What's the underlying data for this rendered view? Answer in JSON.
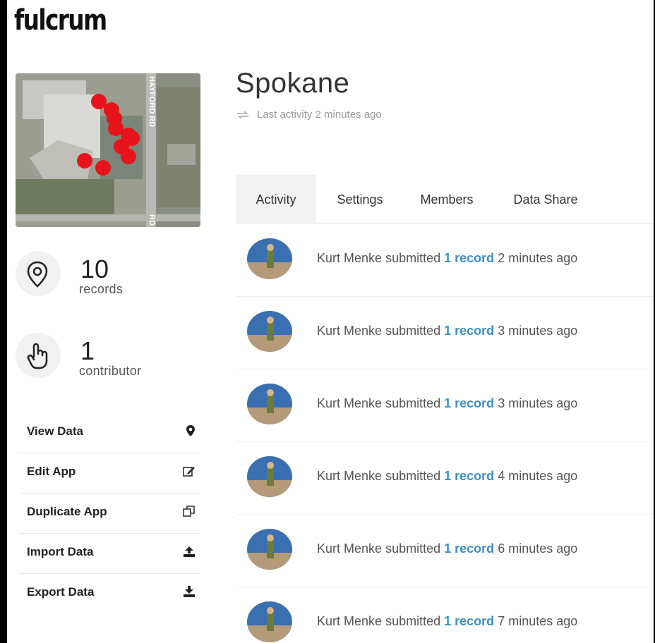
{
  "brand": {
    "logo_text": "fulcrum"
  },
  "app": {
    "title": "Spokane",
    "last_activity": "Last activity 2 minutes ago",
    "map_street_label": "HAYFORD RD",
    "map_street_label_2": "RD"
  },
  "stats": {
    "records": {
      "value": "10",
      "label": "records",
      "icon": "map-pin-icon"
    },
    "contributors": {
      "value": "1",
      "label": "contributor",
      "icon": "hand-pointer-icon"
    }
  },
  "actions": [
    {
      "label": "View Data",
      "icon": "map-marker-icon"
    },
    {
      "label": "Edit App",
      "icon": "edit-icon"
    },
    {
      "label": "Duplicate App",
      "icon": "duplicate-icon"
    },
    {
      "label": "Import Data",
      "icon": "upload-icon"
    },
    {
      "label": "Export Data",
      "icon": "download-icon"
    }
  ],
  "tabs": [
    {
      "label": "Activity",
      "active": true
    },
    {
      "label": "Settings",
      "active": false
    },
    {
      "label": "Members",
      "active": false
    },
    {
      "label": "Data Share",
      "active": false
    }
  ],
  "feed": [
    {
      "user": "Kurt Menke",
      "verb": "submitted",
      "link": "1 record",
      "time": "2 minutes ago"
    },
    {
      "user": "Kurt Menke",
      "verb": "submitted",
      "link": "1 record",
      "time": "3 minutes ago"
    },
    {
      "user": "Kurt Menke",
      "verb": "submitted",
      "link": "1 record",
      "time": "3 minutes ago"
    },
    {
      "user": "Kurt Menke",
      "verb": "submitted",
      "link": "1 record",
      "time": "4 minutes ago"
    },
    {
      "user": "Kurt Menke",
      "verb": "submitted",
      "link": "1 record",
      "time": "6 minutes ago"
    },
    {
      "user": "Kurt Menke",
      "verb": "submitted",
      "link": "1 record",
      "time": "7 minutes ago"
    }
  ],
  "colors": {
    "link": "#3d8fc6",
    "pin": "#e8141b",
    "frame": "#000000"
  }
}
